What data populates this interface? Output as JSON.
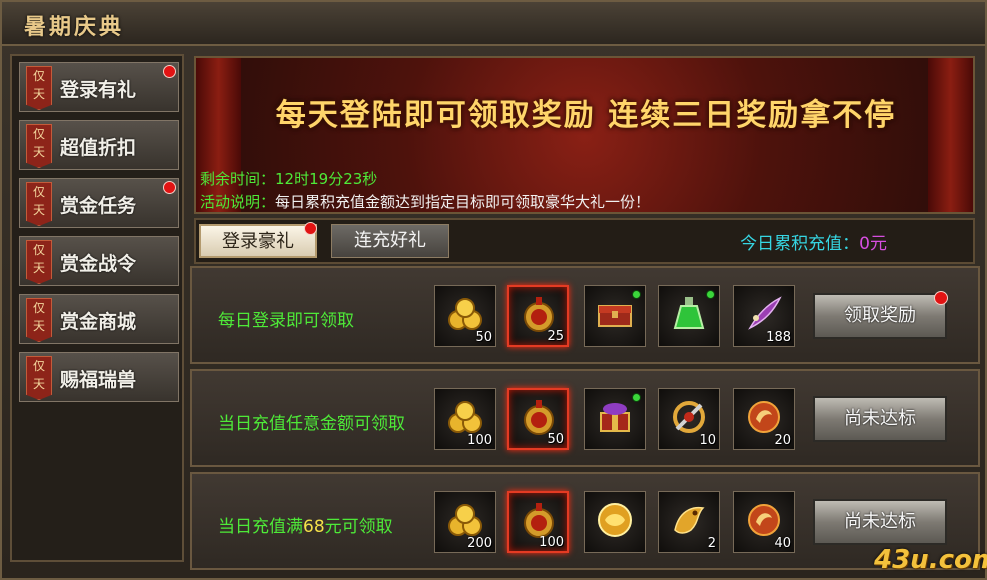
{
  "window": {
    "title": "暑期庆典"
  },
  "sidebar": {
    "badge": [
      "仅",
      "天"
    ],
    "items": [
      {
        "label": "登录有礼",
        "has_dot": true
      },
      {
        "label": "超值折扣",
        "has_dot": false
      },
      {
        "label": "赏金任务",
        "has_dot": true
      },
      {
        "label": "赏金战令",
        "has_dot": false
      },
      {
        "label": "赏金商城",
        "has_dot": false
      },
      {
        "label": "赐福瑞兽",
        "has_dot": false
      }
    ]
  },
  "banner": {
    "headline": "每天登陆即可领取奖励 连续三日奖励拿不停",
    "time_label": "剩余时间：",
    "time_value": "12时19分23秒",
    "desc_label": "活动说明：",
    "desc_value": "每日累积充值金额达到指定目标即可领取豪华大礼一份！"
  },
  "tabs": [
    {
      "label": "登录豪礼",
      "active": true,
      "has_dot": true
    },
    {
      "label": "连充好礼",
      "active": false,
      "has_dot": false
    }
  ],
  "today_recharge": {
    "label": "今日累积充值：",
    "amount": "0元"
  },
  "rows": [
    {
      "label_pre": "每日登录即可领取",
      "label_em": "",
      "label_post": "",
      "button": "领取奖励",
      "button_dot": true,
      "items": [
        {
          "icon": "gold-coins-icon",
          "count": "50",
          "highlight": false,
          "dot": false
        },
        {
          "icon": "red-medal-icon",
          "count": "25",
          "highlight": true,
          "dot": false
        },
        {
          "icon": "treasure-chest-icon",
          "count": "",
          "highlight": false,
          "dot": true
        },
        {
          "icon": "green-potion-icon",
          "count": "",
          "highlight": false,
          "dot": true
        },
        {
          "icon": "purple-feather-icon",
          "count": "188",
          "highlight": false,
          "dot": false
        }
      ]
    },
    {
      "label_pre": "当日充值任意金额可领取",
      "label_em": "",
      "label_post": "",
      "button": "尚未达标",
      "button_dot": false,
      "items": [
        {
          "icon": "gold-coins-icon",
          "count": "100",
          "highlight": false,
          "dot": false
        },
        {
          "icon": "red-medal-icon",
          "count": "50",
          "highlight": true,
          "dot": false
        },
        {
          "icon": "gift-box-icon",
          "count": "",
          "highlight": false,
          "dot": true
        },
        {
          "icon": "golden-amulet-icon",
          "count": "10",
          "highlight": false,
          "dot": false
        },
        {
          "icon": "fire-orb-icon",
          "count": "20",
          "highlight": false,
          "dot": false
        }
      ]
    },
    {
      "label_pre": "当日充值满",
      "label_em": "68",
      "label_post": "元可领取",
      "button": "尚未达标",
      "button_dot": false,
      "items": [
        {
          "icon": "gold-coins-icon",
          "count": "200",
          "highlight": false,
          "dot": false
        },
        {
          "icon": "red-medal-icon",
          "count": "100",
          "highlight": true,
          "dot": false
        },
        {
          "icon": "gold-orb-icon",
          "count": "",
          "highlight": false,
          "dot": false
        },
        {
          "icon": "gold-dragon-icon",
          "count": "2",
          "highlight": false,
          "dot": false
        },
        {
          "icon": "fire-orb-icon",
          "count": "40",
          "highlight": false,
          "dot": false
        }
      ]
    }
  ],
  "watermark": "43u.com"
}
